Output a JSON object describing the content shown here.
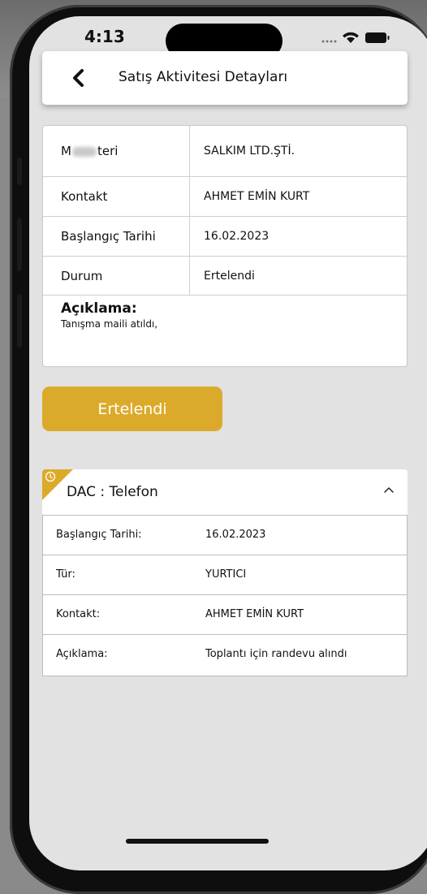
{
  "status_bar": {
    "time": "4:13"
  },
  "header": {
    "title": "Satış Aktivitesi Detayları",
    "back_icon": "chevron-left-icon"
  },
  "info": {
    "rows": [
      {
        "label_start": "M",
        "label_end": "teri",
        "value": "SALKIM LTD.ŞTİ."
      },
      {
        "label": "Kontakt",
        "value": "AHMET EMİN KURT"
      },
      {
        "label": "Başlangıç Tarihi",
        "value": "16.02.2023"
      },
      {
        "label": "Durum",
        "value": "Ertelendi"
      }
    ],
    "description_label": "Açıklama:",
    "description_text": "Tanışma maili atıldı,"
  },
  "status_button": {
    "label": "Ertelendi"
  },
  "activity": {
    "title": "DAC : Telefon",
    "expanded": true,
    "rows": [
      {
        "label": "Başlangıç Tarihi:",
        "value": "16.02.2023"
      },
      {
        "label": "Tür:",
        "value": "YURTICI"
      },
      {
        "label": "Kontakt:",
        "value": "AHMET EMİN KURT"
      },
      {
        "label": "Açıklama:",
        "value": "Toplantı için randevu alındı"
      }
    ]
  },
  "colors": {
    "accent": "#dcaa2b",
    "screen_bg": "#e2e2e2",
    "card_bg": "#ffffff"
  }
}
